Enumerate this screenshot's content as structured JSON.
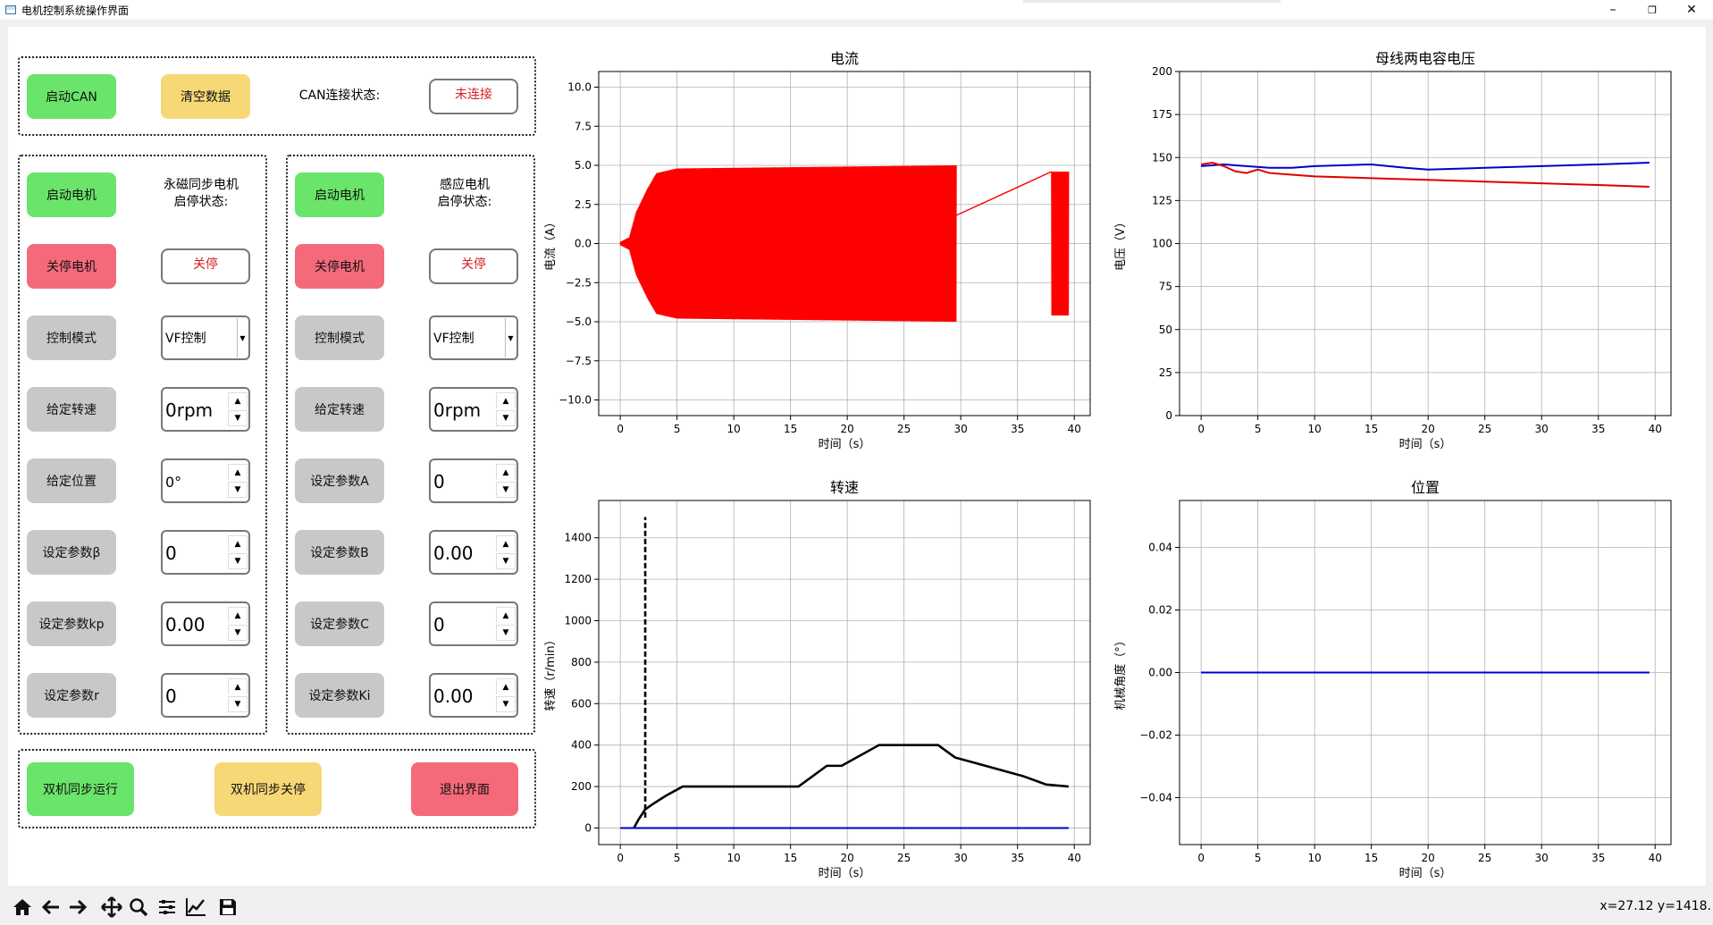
{
  "window": {
    "title": "电机控制系统操作界面"
  },
  "can_group": {
    "start_can": "启动CAN",
    "clear_data": "清空数据",
    "status_label": "CAN连接状态:",
    "status_value": "未连接"
  },
  "pmsm": {
    "start": "启动电机",
    "state_label": "永磁同步电机\n启停状态:",
    "stop": "关停电机",
    "state_value": "关停",
    "mode_label": "控制模式",
    "mode_value": "VF控制",
    "speed_label": "给定转速",
    "speed_value": "0rpm",
    "pos_label": "给定位置",
    "pos_value": "0°",
    "beta_label": "设定参数β",
    "beta_value": "0",
    "kp_label": "设定参数kp",
    "kp_value": "0.00",
    "r_label": "设定参数r",
    "r_value": "0"
  },
  "im": {
    "start": "启动电机",
    "state_label": "感应电机\n启停状态:",
    "stop": "关停电机",
    "state_value": "关停",
    "mode_label": "控制模式",
    "mode_value": "VF控制",
    "speed_label": "给定转速",
    "speed_value": "0rpm",
    "a_label": "设定参数A",
    "a_value": "0",
    "b_label": "设定参数B",
    "b_value": "0.00",
    "c_label": "设定参数C",
    "c_value": "0",
    "ki_label": "设定参数Ki",
    "ki_value": "0.00"
  },
  "bottom_group": {
    "sync_run": "双机同步运行",
    "sync_stop": "双机同步关停",
    "exit": "退出界面"
  },
  "chart_data": [
    {
      "type": "line",
      "title": "电流",
      "xlabel": "时间（s）",
      "ylabel": "电流（A）",
      "xlim": [
        -1.9,
        41.4
      ],
      "ylim": [
        -11,
        11
      ],
      "xticks": [
        0,
        5,
        10,
        15,
        20,
        25,
        30,
        35,
        40
      ],
      "yticks": [
        -10.0,
        -7.5,
        -5.0,
        -2.5,
        0.0,
        2.5,
        5.0,
        7.5,
        10.0
      ],
      "ytick_labels": [
        "−10.0",
        "−7.5",
        "−5.0",
        "−2.5",
        "0.0",
        "2.5",
        "5.0",
        "7.5",
        "10.0"
      ],
      "grid": true,
      "colors": {
        "series": "#ff0000"
      },
      "series": [
        {
          "style": "oscillation",
          "segments": [
            {
              "x_start": 0.0,
              "x_end": 29.6,
              "amplitude_envelope": [
                [
                  0.0,
                  0.1
                ],
                [
                  0.8,
                  0.4
                ],
                [
                  1.4,
                  2.0
                ],
                [
                  2.4,
                  3.5
                ],
                [
                  3.2,
                  4.5
                ],
                [
                  5.0,
                  4.8
                ],
                [
                  29.6,
                  5.0
                ]
              ]
            },
            {
              "x_start": 38.0,
              "x_end": 39.5,
              "amplitude_envelope": [
                [
                  38.0,
                  4.6
                ],
                [
                  39.5,
                  4.6
                ]
              ]
            }
          ],
          "connector": [
            [
              29.6,
              1.8
            ],
            [
              38.0,
              4.6
            ]
          ]
        }
      ]
    },
    {
      "type": "line",
      "title": "母线两电容电压",
      "xlabel": "时间（s）",
      "ylabel": "电压（V）",
      "xlim": [
        -1.9,
        41.4
      ],
      "ylim": [
        0,
        200
      ],
      "xticks": [
        0,
        5,
        10,
        15,
        20,
        25,
        30,
        35,
        40
      ],
      "yticks": [
        0,
        25,
        50,
        75,
        100,
        125,
        150,
        175,
        200
      ],
      "ytick_labels": [
        "0",
        "25",
        "50",
        "75",
        "100",
        "125",
        "150",
        "175",
        "200"
      ],
      "grid": true,
      "series": [
        {
          "color": "#0000cc",
          "x": [
            0,
            2,
            4,
            6,
            8,
            10,
            15,
            18,
            20,
            25,
            30,
            35,
            39.5
          ],
          "y": [
            145,
            146,
            145,
            144,
            144,
            145,
            146,
            144,
            143,
            144,
            145,
            146,
            147
          ]
        },
        {
          "color": "#dd0000",
          "x": [
            0,
            1,
            2,
            3,
            4,
            5,
            6,
            8,
            10,
            15,
            20,
            25,
            30,
            35,
            39.5
          ],
          "y": [
            146,
            147,
            145,
            142,
            141,
            143,
            141,
            140,
            139,
            138,
            137,
            136,
            135,
            134,
            133
          ]
        }
      ]
    },
    {
      "type": "line",
      "title": "转速",
      "xlabel": "时间（s）",
      "ylabel": "转速（r/min）",
      "xlim": [
        -1.9,
        41.4
      ],
      "ylim": [
        -80,
        1580
      ],
      "xticks": [
        0,
        5,
        10,
        15,
        20,
        25,
        30,
        35,
        40
      ],
      "yticks": [
        0,
        200,
        400,
        600,
        800,
        1000,
        1200,
        1400
      ],
      "ytick_labels": [
        "0",
        "200",
        "400",
        "600",
        "800",
        "1000",
        "1200",
        "1400"
      ],
      "grid": true,
      "series": [
        {
          "color": "#000000",
          "style": "dashed",
          "x": [
            2.2,
            2.2
          ],
          "y": [
            50,
            1500
          ]
        },
        {
          "color": "#000000",
          "x": [
            1.2,
            1.6,
            2.2,
            3.0,
            4.0,
            5.5,
            8,
            10,
            14,
            15.7,
            18.2,
            19.5,
            22.8,
            28,
            29.5,
            31.5,
            33.5,
            35.5,
            37.5,
            39.5
          ],
          "y": [
            0,
            40,
            90,
            120,
            155,
            200,
            200,
            200,
            200,
            200,
            300,
            300,
            400,
            400,
            340,
            310,
            280,
            250,
            210,
            200
          ]
        },
        {
          "color": "#0000cc",
          "x": [
            0,
            39.5
          ],
          "y": [
            0,
            0
          ]
        }
      ]
    },
    {
      "type": "line",
      "title": "位置",
      "xlabel": "时间（s）",
      "ylabel": "机械角度（°）",
      "xlim": [
        -1.9,
        41.4
      ],
      "ylim": [
        -0.055,
        0.055
      ],
      "xticks": [
        0,
        5,
        10,
        15,
        20,
        25,
        30,
        35,
        40
      ],
      "yticks": [
        -0.04,
        -0.02,
        0.0,
        0.02,
        0.04
      ],
      "ytick_labels": [
        "−0.04",
        "−0.02",
        "0.00",
        "0.02",
        "0.04"
      ],
      "grid": true,
      "series": [
        {
          "color": "#0000cc",
          "x": [
            0,
            39.5
          ],
          "y": [
            0,
            0
          ]
        }
      ]
    }
  ],
  "toolbar": {
    "icons": [
      "home-icon",
      "back-arrow-icon",
      "forward-arrow-icon",
      "pan-icon",
      "zoom-icon",
      "configure-subplots-icon",
      "edit-axis-icon",
      "save-icon"
    ],
    "coords": "x=27.12 y=1418."
  }
}
